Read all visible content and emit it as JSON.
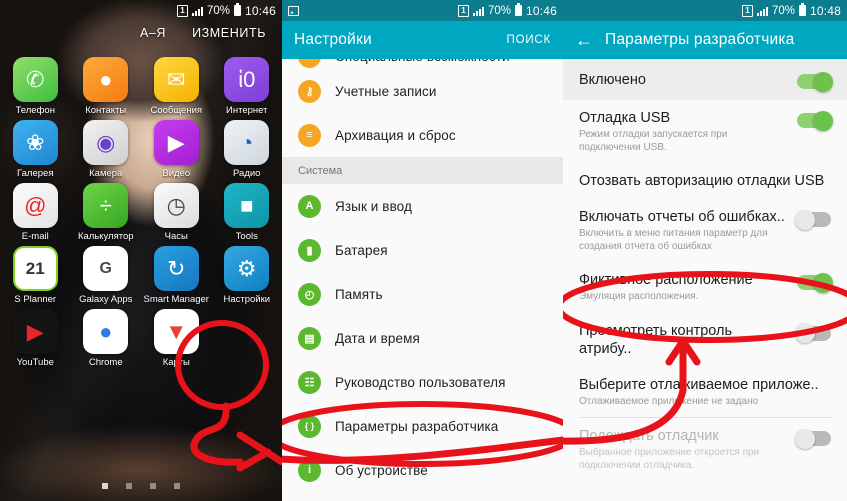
{
  "panel1": {
    "status": {
      "time": "10:46",
      "battery_pct": "70%",
      "sim": "1"
    },
    "header": {
      "sort_label": "А–Я",
      "edit_label": "ИЗМЕНИТЬ"
    },
    "apps": [
      [
        {
          "label": "Телефон",
          "icon": "phone-icon",
          "cls": "ic-phone",
          "glyph": "✆"
        },
        {
          "label": "Контакты",
          "icon": "contacts-icon",
          "cls": "ic-contacts",
          "glyph": "●"
        },
        {
          "label": "Сообщения",
          "icon": "messages-icon",
          "cls": "ic-msg",
          "glyph": "✉"
        },
        {
          "label": "Интернет",
          "icon": "internet-icon",
          "cls": "ic-net",
          "glyph": "ἱ0"
        }
      ],
      [
        {
          "label": "Галерея",
          "icon": "gallery-icon",
          "cls": "ic-gallery",
          "glyph": "❀"
        },
        {
          "label": "Камера",
          "icon": "camera-icon",
          "cls": "ic-camera",
          "glyph": "◉"
        },
        {
          "label": "Видео",
          "icon": "video-icon",
          "cls": "ic-video",
          "glyph": "▶"
        },
        {
          "label": "Радио",
          "icon": "radio-icon",
          "cls": "ic-radio",
          "glyph": "◔"
        }
      ],
      [
        {
          "label": "E-mail",
          "icon": "email-icon",
          "cls": "ic-email",
          "glyph": "@"
        },
        {
          "label": "Калькулятор",
          "icon": "calculator-icon",
          "cls": "ic-calc",
          "glyph": "÷"
        },
        {
          "label": "Часы",
          "icon": "clock-icon",
          "cls": "ic-clock",
          "glyph": "◷"
        },
        {
          "label": "Tools",
          "icon": "tools-folder-icon",
          "cls": "ic-tools",
          "glyph": "■"
        }
      ],
      [
        {
          "label": "S Planner",
          "icon": "s-planner-icon",
          "cls": "ic-planner",
          "glyph": "21"
        },
        {
          "label": "Galaxy Apps",
          "icon": "galaxy-apps-icon",
          "cls": "ic-galaxy",
          "glyph": "G"
        },
        {
          "label": "Smart Manager",
          "icon": "smart-manager-icon",
          "cls": "ic-smart",
          "glyph": "↻"
        },
        {
          "label": "Настройки",
          "icon": "settings-gear-icon",
          "cls": "ic-settings",
          "glyph": "⚙"
        }
      ],
      [
        {
          "label": "YouTube",
          "icon": "youtube-icon",
          "cls": "ic-youtube",
          "glyph": "▶"
        },
        {
          "label": "Chrome",
          "icon": "chrome-icon",
          "cls": "ic-chrome",
          "glyph": "●"
        },
        {
          "label": "Карты",
          "icon": "maps-icon",
          "cls": "ic-maps",
          "glyph": "▼"
        }
      ]
    ],
    "pager": {
      "pages": 4,
      "active": 0
    }
  },
  "panel2": {
    "status": {
      "time": "10:46",
      "battery_pct": "70%",
      "sim": "1"
    },
    "appbar": {
      "title": "Настройки",
      "action": "ПОИСК"
    },
    "items": [
      {
        "label": "Специальные возможности",
        "icon": "accessibility-icon",
        "color": "ic-orange",
        "glyph": "✓",
        "clipped": true
      },
      {
        "label": "Учетные записи",
        "icon": "accounts-key-icon",
        "color": "ic-orange",
        "glyph": "⚷"
      },
      {
        "label": "Архивация и сброс",
        "icon": "backup-reset-icon",
        "color": "ic-orange",
        "glyph": "≡"
      }
    ],
    "section_label": "Система",
    "system_items": [
      {
        "label": "Язык и ввод",
        "icon": "language-input-icon",
        "color": "ic-green",
        "glyph": "A"
      },
      {
        "label": "Батарея",
        "icon": "battery-icon",
        "color": "ic-green",
        "glyph": "▮"
      },
      {
        "label": "Память",
        "icon": "storage-icon",
        "color": "ic-green",
        "glyph": "◴"
      },
      {
        "label": "Дата и время",
        "icon": "date-time-icon",
        "color": "ic-green",
        "glyph": "▤"
      },
      {
        "label": "Руководство пользователя",
        "icon": "user-manual-icon",
        "color": "ic-green",
        "glyph": "☷"
      },
      {
        "label": "Параметры разработчика",
        "icon": "developer-options-icon",
        "color": "ic-green",
        "glyph": "{ }",
        "highlighted": true
      },
      {
        "label": "Об устройстве",
        "icon": "about-device-icon",
        "color": "ic-green",
        "glyph": "i"
      }
    ]
  },
  "panel3": {
    "status": {
      "time": "10:48",
      "battery_pct": "70%",
      "sim": "1"
    },
    "appbar": {
      "title": "Параметры разработчика",
      "back": "←"
    },
    "master": {
      "label": "Включено",
      "toggle": "on"
    },
    "items": [
      {
        "title": "Отладка USB",
        "sub": "Режим отладки запускается при подключении USB.",
        "toggle": "on",
        "dim": false
      },
      {
        "title": "Отозвать авторизацию отладки USB",
        "sub": "",
        "toggle": "none",
        "dim": false
      },
      {
        "title": "Включать отчеты об ошибках..",
        "sub": "Включить в меню питания параметр для создания отчета об ошибках",
        "toggle": "off",
        "dim": false
      },
      {
        "title": "Фиктивное расположение",
        "sub": "Эмуляция расположения.",
        "toggle": "on",
        "dim": false,
        "highlighted": true
      },
      {
        "title": "Просмотреть контроль атрибу..",
        "sub": "",
        "toggle": "off",
        "dim": false
      },
      {
        "title": "Выберите отлаживаемое приложе..",
        "sub": "Отлаживаемое приложение не задано",
        "toggle": "none",
        "dim": false,
        "divider_after": true
      },
      {
        "title": "Подождать отладчик",
        "sub": "Выбранное приложение откроется при подключении отладчика.",
        "toggle": "off",
        "dim": true
      }
    ]
  },
  "annotations": {
    "color": "#e8131a",
    "marks": [
      "circle-around-settings-icon",
      "arrow-settings-to-developer-options",
      "circle-around-developer-options",
      "arrow-developer-options-to-mock-location",
      "circle-around-mock-location"
    ]
  }
}
